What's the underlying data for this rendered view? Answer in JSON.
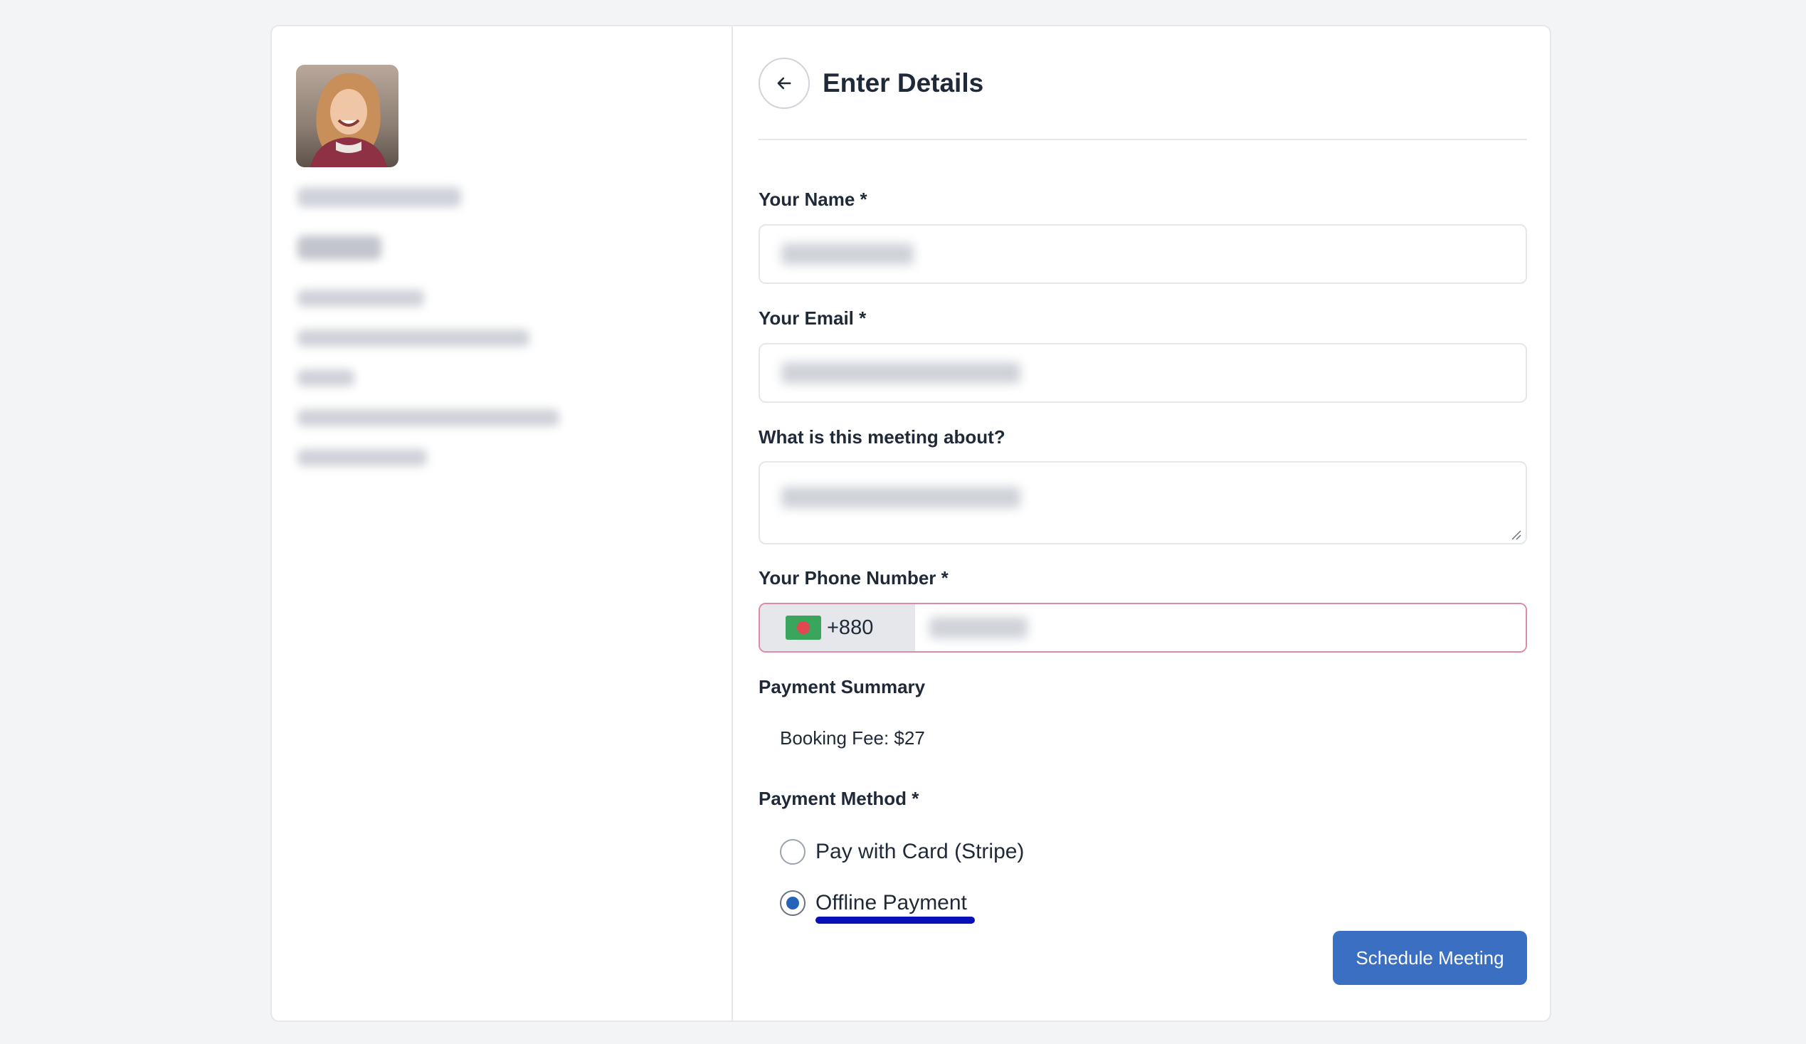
{
  "header": {
    "title": "Enter Details"
  },
  "form": {
    "name_label": "Your Name *",
    "email_label": "Your Email *",
    "about_label": "What is this meeting about?",
    "phone_label": "Your Phone Number *",
    "phone_dial_code": "+880",
    "phone_flag_icon": "bangladesh-flag-icon"
  },
  "payment": {
    "summary_label": "Payment Summary",
    "fee_text": "Booking Fee: $27",
    "method_label": "Payment Method *",
    "options": [
      {
        "label": "Pay with Card (Stripe)",
        "selected": false
      },
      {
        "label": "Offline Payment",
        "selected": true
      }
    ]
  },
  "actions": {
    "submit_label": "Schedule Meeting"
  },
  "colors": {
    "primary_button": "#3b6fc2",
    "radio_selected": "#2563b8",
    "phone_border": "#e08aa8",
    "highlight_underline": "#0a10b8"
  }
}
